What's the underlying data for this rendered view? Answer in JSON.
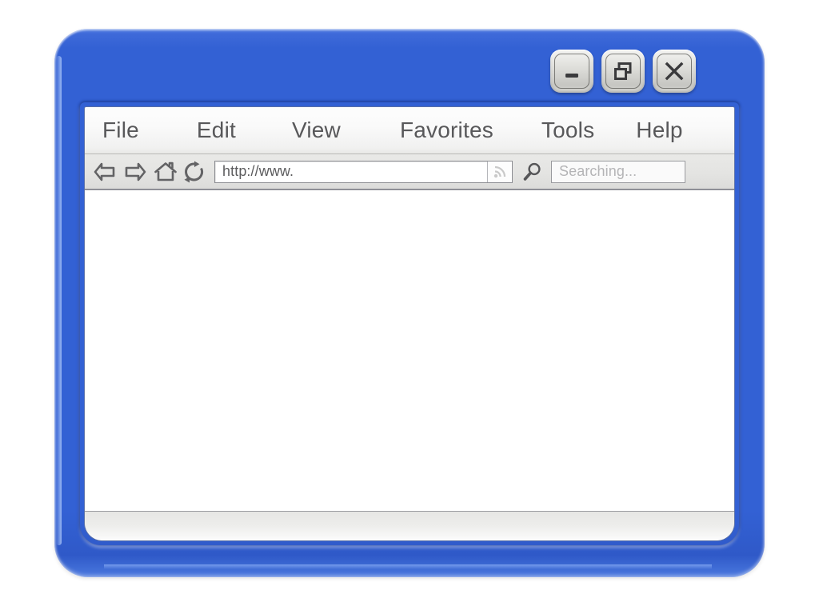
{
  "window": {
    "frame_color": "#3361d4",
    "controls": [
      {
        "name": "minimize-button",
        "icon": "minimize-icon",
        "label": "Minimize"
      },
      {
        "name": "restore-button",
        "icon": "restore-icon",
        "label": "Restore"
      },
      {
        "name": "close-button",
        "icon": "close-icon",
        "label": "Close"
      }
    ]
  },
  "menu": {
    "items": [
      {
        "label": "File"
      },
      {
        "label": "Edit"
      },
      {
        "label": "View"
      },
      {
        "label": "Favorites"
      },
      {
        "label": "Tools"
      },
      {
        "label": "Help"
      }
    ]
  },
  "toolbar": {
    "nav_icons": [
      {
        "name": "back-icon",
        "label": "Back"
      },
      {
        "name": "forward-icon",
        "label": "Forward"
      },
      {
        "name": "home-icon",
        "label": "Home"
      },
      {
        "name": "refresh-icon",
        "label": "Refresh"
      }
    ],
    "address_bar": {
      "value": "http://www.",
      "placeholder": "http://www.",
      "rss_icon": "rss-feed-icon"
    },
    "search": {
      "icon": "magnifier-icon",
      "value": "",
      "placeholder": "Searching..."
    }
  },
  "content": {
    "body_text": ""
  },
  "status_bar": {
    "text": ""
  }
}
